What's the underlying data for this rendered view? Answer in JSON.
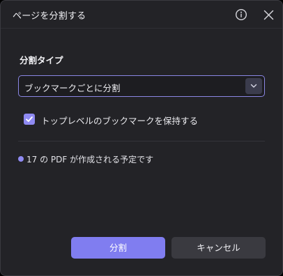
{
  "dialog": {
    "title": "ページを分割する"
  },
  "split_type": {
    "label": "分割タイプ",
    "selected": "ブックマークごとに分割"
  },
  "option": {
    "keep_top_level_label": "トップレベルのブックマークを保持する",
    "keep_top_level_checked": true
  },
  "note": {
    "text": "17 の PDF が作成される予定です"
  },
  "buttons": {
    "split": "分割",
    "cancel": "キャンセル"
  },
  "icons": {
    "info": "info-icon",
    "close": "close-icon",
    "dropdown": "chevron-down-icon",
    "check": "check-icon"
  },
  "colors": {
    "accent": "#807df0",
    "dialog_bg": "#232327",
    "select_border": "#8b87e4",
    "secondary_button": "#3a3a40"
  }
}
